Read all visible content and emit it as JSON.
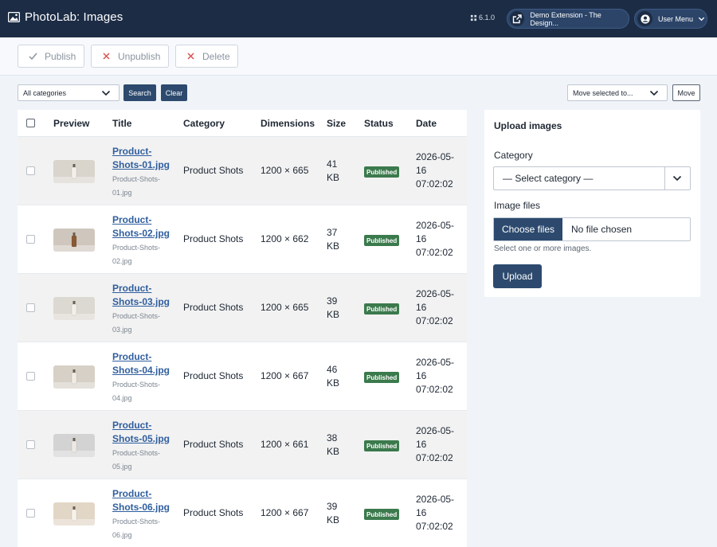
{
  "header": {
    "app_title": "PhotoLab: Images",
    "version": "6.1.0",
    "extension_link": "Demo Extension - The Design...",
    "user_menu": "User Menu"
  },
  "toolbar": {
    "publish": "Publish",
    "unpublish": "Unpublish",
    "delete": "Delete"
  },
  "filters": {
    "category_selected": "All categories",
    "search": "Search",
    "clear": "Clear",
    "move_selected": "Move selected to...",
    "move": "Move"
  },
  "table": {
    "columns": [
      "Preview",
      "Title",
      "Category",
      "Dimensions",
      "Size",
      "Status",
      "Date"
    ],
    "rows": [
      {
        "title": "Product-Shots-01.jpg",
        "filename": "Product-Shots-01.jpg",
        "category": "Product Shots",
        "dimensions": "1200 × 665",
        "size": "41 KB",
        "status": "Published",
        "date": "2026-05-16 07:02:02"
      },
      {
        "title": "Product-Shots-02.jpg",
        "filename": "Product-Shots-02.jpg",
        "category": "Product Shots",
        "dimensions": "1200 × 662",
        "size": "37 KB",
        "status": "Published",
        "date": "2026-05-16 07:02:02"
      },
      {
        "title": "Product-Shots-03.jpg",
        "filename": "Product-Shots-03.jpg",
        "category": "Product Shots",
        "dimensions": "1200 × 665",
        "size": "39 KB",
        "status": "Published",
        "date": "2026-05-16 07:02:02"
      },
      {
        "title": "Product-Shots-04.jpg",
        "filename": "Product-Shots-04.jpg",
        "category": "Product Shots",
        "dimensions": "1200 × 667",
        "size": "46 KB",
        "status": "Published",
        "date": "2026-05-16 07:02:02"
      },
      {
        "title": "Product-Shots-05.jpg",
        "filename": "Product-Shots-05.jpg",
        "category": "Product Shots",
        "dimensions": "1200 × 661",
        "size": "38 KB",
        "status": "Published",
        "date": "2026-05-16 07:02:02"
      },
      {
        "title": "Product-Shots-06.jpg",
        "filename": "Product-Shots-06.jpg",
        "category": "Product Shots",
        "dimensions": "1200 × 667",
        "size": "39 KB",
        "status": "Published",
        "date": "2026-05-16 07:02:02"
      }
    ]
  },
  "upload": {
    "heading": "Upload images",
    "category_label": "Category",
    "category_placeholder": "— Select category —",
    "files_label": "Image files",
    "choose_files": "Choose files",
    "no_file": "No file chosen",
    "hint": "Select one or more images.",
    "upload_button": "Upload"
  },
  "colors": {
    "header_bg": "#1c2c45",
    "primary": "#2d4a6e",
    "published": "#3b7a4c",
    "link": "#2f5e9e"
  }
}
